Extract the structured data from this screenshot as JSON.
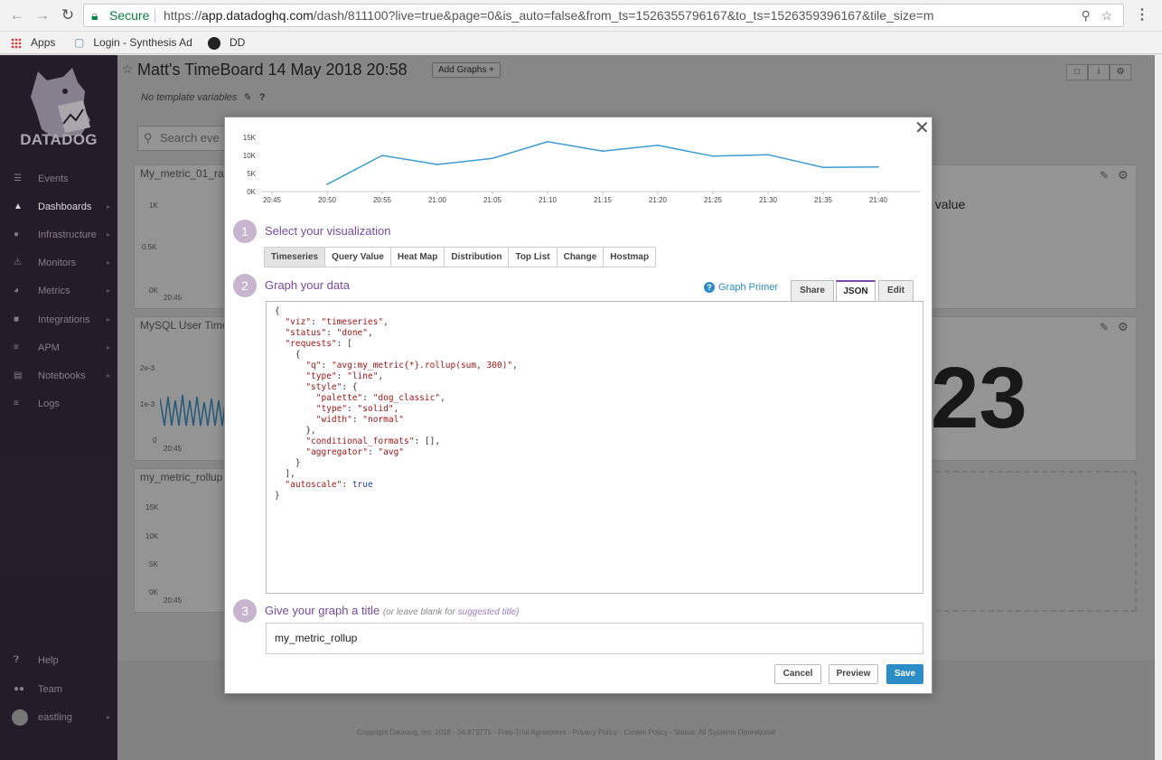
{
  "browser": {
    "secure_label": "Secure",
    "url_prefix": "https://",
    "url_host": "app.datadoghq.com",
    "url_rest": "/dash/811100?live=true&page=0&is_auto=false&from_ts=1526355796167&to_ts=1526359396167&tile_size=m",
    "bookmarks": [
      "Apps",
      "Login - Synthesis Ad",
      "DD"
    ]
  },
  "sidebar": {
    "logo_text": "DATADOG",
    "items": [
      {
        "label": "Events",
        "icon": "list-icon"
      },
      {
        "label": "Dashboards",
        "icon": "chart-icon"
      },
      {
        "label": "Infrastructure",
        "icon": "nodes-icon"
      },
      {
        "label": "Monitors",
        "icon": "alert-icon"
      },
      {
        "label": "Metrics",
        "icon": "gauge-icon"
      },
      {
        "label": "Integrations",
        "icon": "puzzle-icon"
      },
      {
        "label": "APM",
        "icon": "trace-icon"
      },
      {
        "label": "Notebooks",
        "icon": "notebook-icon"
      },
      {
        "label": "Logs",
        "icon": "logs-icon"
      }
    ],
    "bottom": [
      {
        "label": "Help",
        "icon": "help-icon"
      },
      {
        "label": "Team",
        "icon": "team-icon"
      },
      {
        "label": "eastling",
        "icon": "avatar"
      }
    ]
  },
  "dashboard": {
    "title": "Matt's TimeBoard 14 May 2018 20:58",
    "add_graphs": "Add Graphs +",
    "template_vars": "No template variables",
    "search_placeholder": "Search eve",
    "widgets": [
      {
        "title": "My_metric_01_ra",
        "y_ticks": [
          "1K",
          "0.5K",
          "0K"
        ],
        "x_tick": "20:45"
      },
      {
        "title": "MySQL User Time",
        "y_ticks": [
          "2e-3",
          "1e-3",
          "0"
        ],
        "x_tick": "20:45"
      },
      {
        "title": "my_metric_rollup",
        "y_ticks": [
          "15K",
          "10K",
          "5K",
          "0K"
        ],
        "x_tick": "20:45"
      }
    ],
    "value_label_fragment": "t value",
    "big_value": "23",
    "footer": "Copyright Datadog, Inc. 2018 - 34.879775 - Free-Trial Agreement - Privacy Policy - Cookie Policy - Status: All Systems Operational"
  },
  "modal": {
    "chart_data": {
      "type": "line",
      "x": [
        "20:50",
        "20:55",
        "21:00",
        "21:05",
        "21:10",
        "21:15",
        "21:20",
        "21:25",
        "21:30",
        "21:35",
        "21:40"
      ],
      "values": [
        2000,
        10000,
        7500,
        9200,
        13800,
        11200,
        12800,
        9800,
        10200,
        6700,
        6800
      ],
      "x_ticks": [
        "20:45",
        "20:50",
        "20:55",
        "21:00",
        "21:05",
        "21:10",
        "21:15",
        "21:20",
        "21:25",
        "21:30",
        "21:35",
        "21:40"
      ],
      "y_ticks": [
        "15K",
        "10K",
        "5K",
        "0K"
      ],
      "ylim": [
        0,
        15000
      ],
      "color": "#3c9bd1"
    },
    "step1": {
      "number": "1",
      "title": "Select your visualization"
    },
    "viz_tabs": [
      "Timeseries",
      "Query Value",
      "Heat Map",
      "Distribution",
      "Top List",
      "Change",
      "Hostmap"
    ],
    "viz_selected": "Timeseries",
    "step2": {
      "number": "2",
      "title": "Graph your data"
    },
    "graph_primer": "Graph Primer",
    "edit_tabs": [
      "Share",
      "JSON",
      "Edit"
    ],
    "edit_selected": "JSON",
    "step3": {
      "number": "3",
      "title": "Give your graph a title",
      "hint": "(or leave blank for ",
      "hint_link": "suggested title",
      "hint_end": ")"
    },
    "title_value": "my_metric_rollup",
    "buttons": {
      "cancel": "Cancel",
      "preview": "Preview",
      "save": "Save"
    },
    "json_lines": [
      "{",
      "  \"viz\": \"timeseries\",",
      "  \"status\": \"done\",",
      "  \"requests\": [",
      "    {",
      "      \"q\": \"avg:my_metric{*}.rollup(sum, 300)\",",
      "      \"type\": \"line\",",
      "      \"style\": {",
      "        \"palette\": \"dog_classic\",",
      "        \"type\": \"solid\",",
      "        \"width\": \"normal\"",
      "      },",
      "      \"conditional_formats\": [],",
      "      \"aggregator\": \"avg\"",
      "    }",
      "  ],",
      "  \"autoscale\": true",
      "}"
    ]
  }
}
